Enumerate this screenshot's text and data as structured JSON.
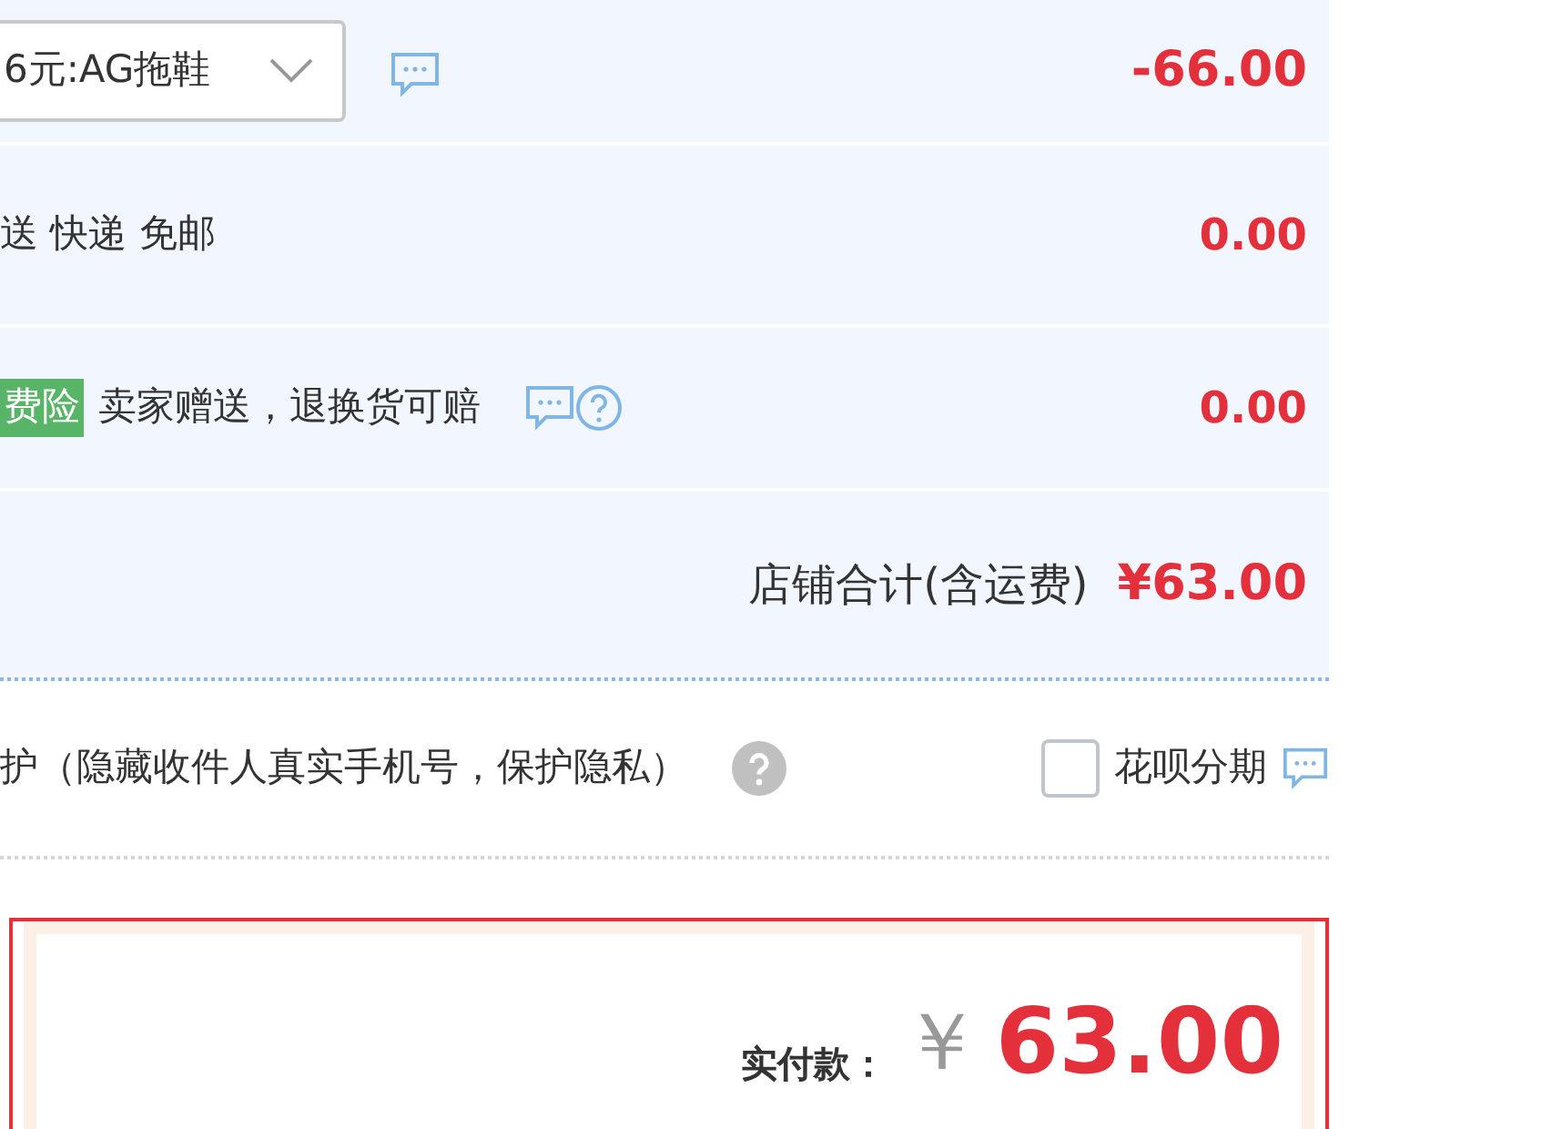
{
  "promo_row": {
    "select_value": "6元:AG拖鞋",
    "amount": "-66.00"
  },
  "delivery_row": {
    "text": "送 快递 免邮",
    "amount": "0.00"
  },
  "insurance_row": {
    "tag": "费险",
    "text": "卖家赠送，退换货可赔",
    "amount": "0.00"
  },
  "shop_total": {
    "label": "店铺合计(含运费)",
    "amount": "¥63.00"
  },
  "options_row": {
    "privacy_text": "护（隐藏收件人真实手机号，保护隐私）",
    "installment": {
      "label": "花呗分期",
      "checked": false
    }
  },
  "payment": {
    "label": "实付款：",
    "currency": "￥",
    "amount": "63.00"
  }
}
